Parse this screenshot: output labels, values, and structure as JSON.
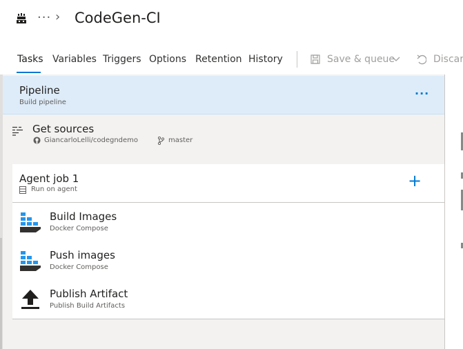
{
  "header": {
    "breadcrumb_more": "···",
    "breadcrumb_chevron": "›",
    "title": "CodeGen-CI"
  },
  "tabs": [
    {
      "label": "Tasks",
      "active": true
    },
    {
      "label": "Variables"
    },
    {
      "label": "Triggers"
    },
    {
      "label": "Options"
    },
    {
      "label": "Retention"
    },
    {
      "label": "History"
    }
  ],
  "toolbar": {
    "save_queue_label": "Save & queue",
    "discard_label": "Discard"
  },
  "pipeline": {
    "title": "Pipeline",
    "subtitle": "Build pipeline",
    "more": "···"
  },
  "sources": {
    "title": "Get sources",
    "repo": "GiancarloLelli/codegndemo",
    "branch": "master"
  },
  "agent_job": {
    "title": "Agent job 1",
    "subtitle": "Run on agent",
    "add": "+"
  },
  "tasks": [
    {
      "title": "Build Images",
      "subtitle": "Docker Compose",
      "icon": "docker-compose-icon"
    },
    {
      "title": "Push images",
      "subtitle": "Docker Compose",
      "icon": "docker-compose-icon"
    },
    {
      "title": "Publish Artifact",
      "subtitle": "Publish Build Artifacts",
      "icon": "upload-arrow-icon"
    }
  ],
  "colors": {
    "accent": "#0078d4",
    "selected_row": "#deecf9",
    "canvas": "#f3f2f1"
  }
}
